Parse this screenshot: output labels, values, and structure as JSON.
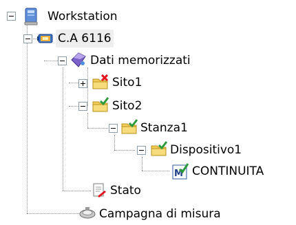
{
  "tree": {
    "workstation": {
      "label": "Workstation",
      "expanded": true
    },
    "instrument": {
      "label": "C.A 6116",
      "expanded": true,
      "selected": true
    },
    "stored_data": {
      "label": "Dati memorizzati",
      "expanded": true
    },
    "site1": {
      "label": "Sito1",
      "expanded": false,
      "status": "error"
    },
    "site2": {
      "label": "Sito2",
      "expanded": true,
      "status": "ok"
    },
    "room1": {
      "label": "Stanza1",
      "expanded": true,
      "status": "ok"
    },
    "device1": {
      "label": "Dispositivo1",
      "expanded": true,
      "status": "ok"
    },
    "measurement": {
      "label": "CONTINUITA",
      "status": "ok"
    },
    "status": {
      "label": "Stato"
    },
    "campaign": {
      "label": "Campagna di misura"
    }
  },
  "colors": {
    "folder": "#f3cf5a",
    "check": "#2b9a3b",
    "error": "#e3121b",
    "selection": "#eeeeee"
  }
}
